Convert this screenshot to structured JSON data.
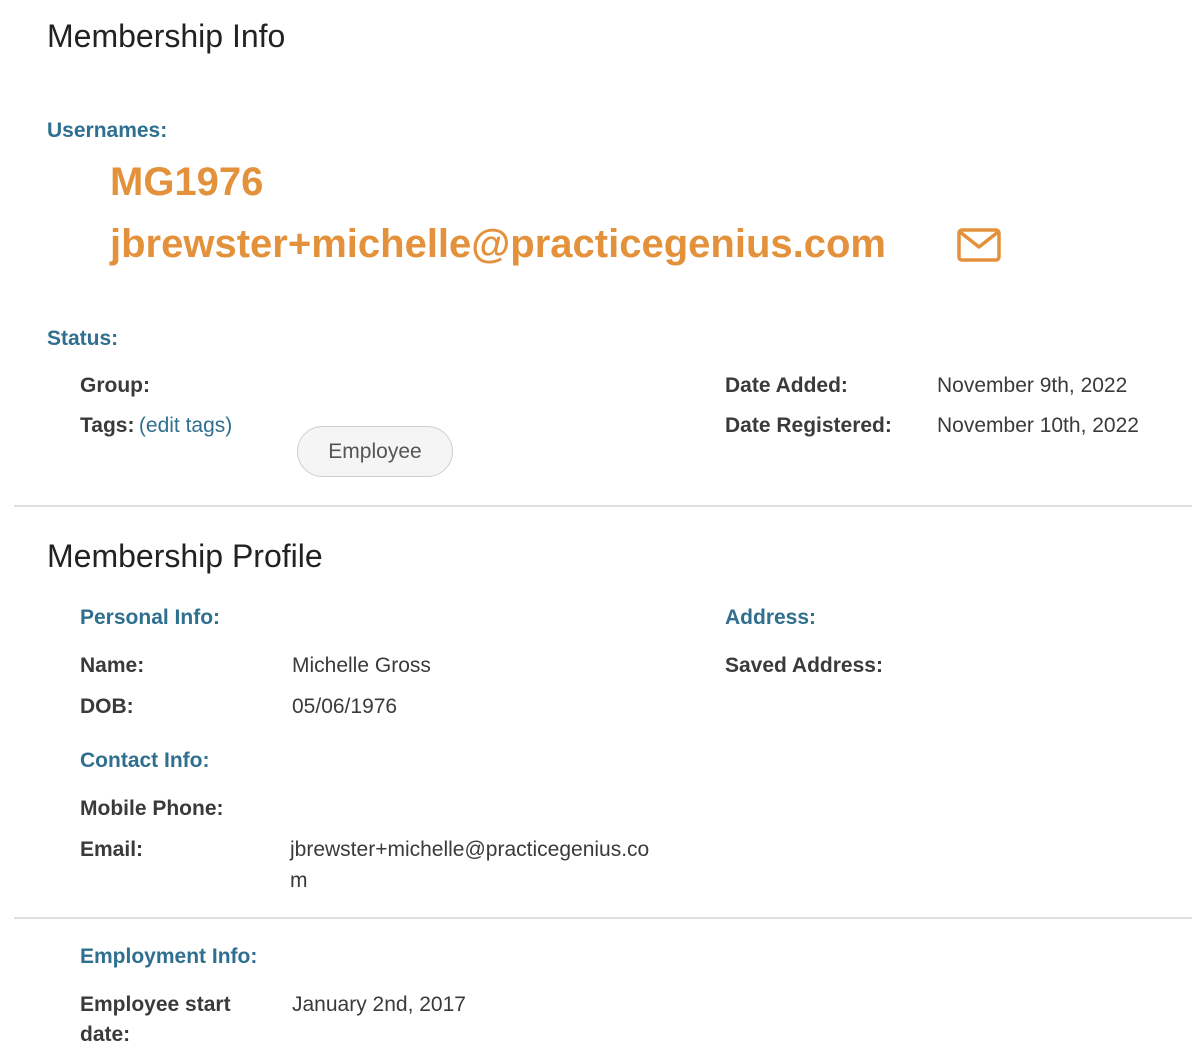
{
  "membership_info": {
    "title": "Membership Info",
    "usernames_label": "Usernames:",
    "usernames": [
      "MG1976",
      "jbrewster+michelle@practicegenius.com"
    ],
    "status_label": "Status:",
    "group_label": "Group:",
    "tags_label": "Tags:",
    "edit_tags_link": "(edit tags)",
    "tags": [
      "Employee"
    ],
    "date_added_label": "Date Added:",
    "date_added": "November 9th, 2022",
    "date_registered_label": "Date Registered:",
    "date_registered": "November 10th, 2022",
    "mail_icon": "envelope-icon",
    "accent_color": "#e3913b",
    "label_color": "#2f6f8f"
  },
  "membership_profile": {
    "title": "Membership Profile",
    "personal_info": {
      "label": "Personal Info:",
      "name_label": "Name:",
      "name": "Michelle Gross",
      "dob_label": "DOB:",
      "dob": "05/06/1976"
    },
    "address": {
      "label": "Address:",
      "saved_address_label": "Saved Address:"
    },
    "contact_info": {
      "label": "Contact Info:",
      "mobile_phone_label": "Mobile Phone:",
      "email_label": "Email:",
      "email_line1": "jbrewster+michelle@practicegenius.co",
      "email_line2": "m"
    },
    "employment_info": {
      "label": "Employment Info:",
      "start_date_label_line1": "Employee start",
      "start_date_label_line2": "date:",
      "start_date": "January 2nd, 2017"
    }
  }
}
